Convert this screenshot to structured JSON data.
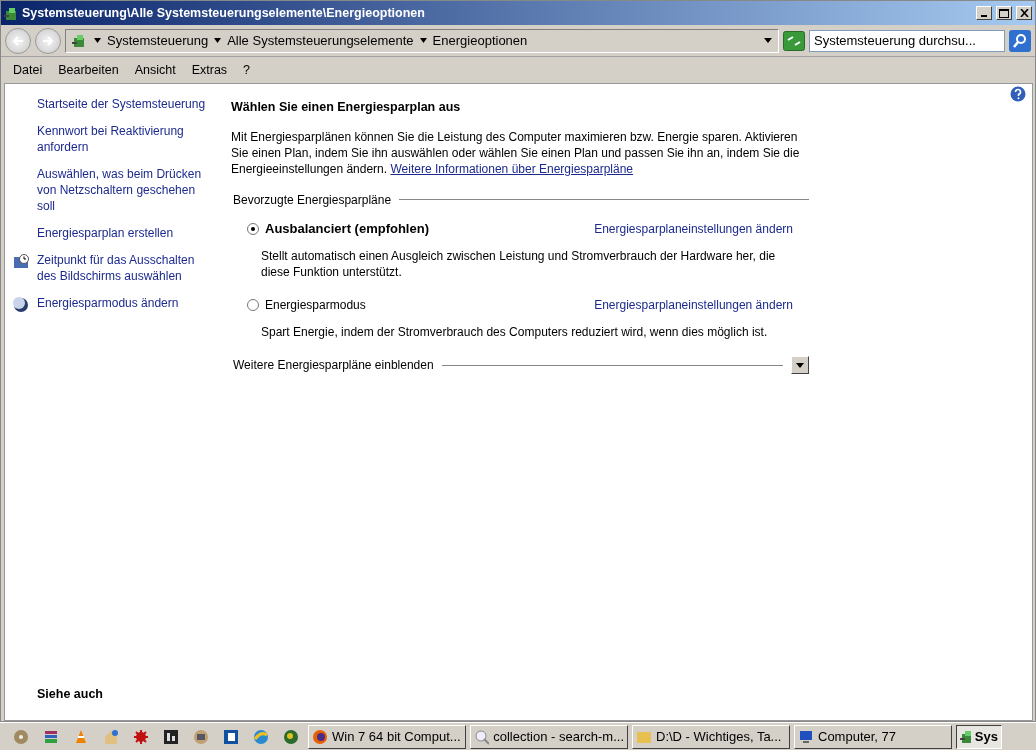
{
  "window": {
    "title": "Systemsteuerung\\Alle Systemsteuerungselemente\\Energieoptionen"
  },
  "address_bar": {
    "crumbs": [
      "Systemsteuerung",
      "Alle Systemsteuerungselemente",
      "Energieoptionen"
    ]
  },
  "search": {
    "placeholder": "Systemsteuerung durchsu..."
  },
  "menu": [
    {
      "label": "Datei"
    },
    {
      "label": "Bearbeiten"
    },
    {
      "label": "Ansicht"
    },
    {
      "label": "Extras"
    },
    {
      "label": "?"
    }
  ],
  "sidebar": {
    "links": [
      {
        "label": "Startseite der Systemsteuerung",
        "kind": "plain"
      },
      {
        "label": "Kennwort bei Reaktivierung anfordern",
        "kind": "plain"
      },
      {
        "label": "Auswählen, was beim Drücken von Netzschaltern geschehen soll",
        "kind": "plain"
      },
      {
        "label": "Energiesparplan erstellen",
        "kind": "plain"
      },
      {
        "label": "Zeitpunkt für das Ausschalten des Bildschirms auswählen",
        "kind": "monitor"
      },
      {
        "label": "Energiesparmodus ändern",
        "kind": "moon"
      }
    ],
    "see_also": "Siehe auch"
  },
  "main": {
    "heading": "Wählen Sie einen Energiesparplan aus",
    "intro": "Mit Energiesparplänen können Sie die Leistung des Computer maximieren bzw. Energie sparen. Aktivieren Sie einen Plan, indem Sie ihn auswählen oder wählen Sie einen Plan und passen Sie ihn an, indem Sie die Energieeinstellungen ändern.",
    "intro_link": "Weitere Informationen über Energiesparpläne",
    "group_title": "Bevorzugte Energiesparpläne",
    "plans": [
      {
        "name": "Ausbalanciert (empfohlen)",
        "selected": true,
        "link": "Energiesparplaneinstellungen ändern",
        "description": "Stellt automatisch einen Ausgleich zwischen Leistung und Stromverbrauch der Hardware her, die diese Funktion unterstützt."
      },
      {
        "name": "Energiesparmodus",
        "selected": false,
        "link": "Energiesparplaneinstellungen ändern",
        "description": "Spart Energie, indem der Stromverbrauch des Computers reduziert wird, wenn dies möglich ist."
      }
    ],
    "more_plans": {
      "label": "Weitere Energiesparpläne einblenden",
      "expanded": false
    }
  },
  "taskbar": {
    "tasks": [
      {
        "label": "Win 7 64 bit Comput...",
        "selected": false
      },
      {
        "label": "collection - search-m...",
        "selected": false
      },
      {
        "label": "D:\\D - Wichtiges, Ta...",
        "selected": false
      },
      {
        "label": "Computer, 77",
        "selected": false
      },
      {
        "label": "Sys",
        "selected": true
      }
    ]
  }
}
